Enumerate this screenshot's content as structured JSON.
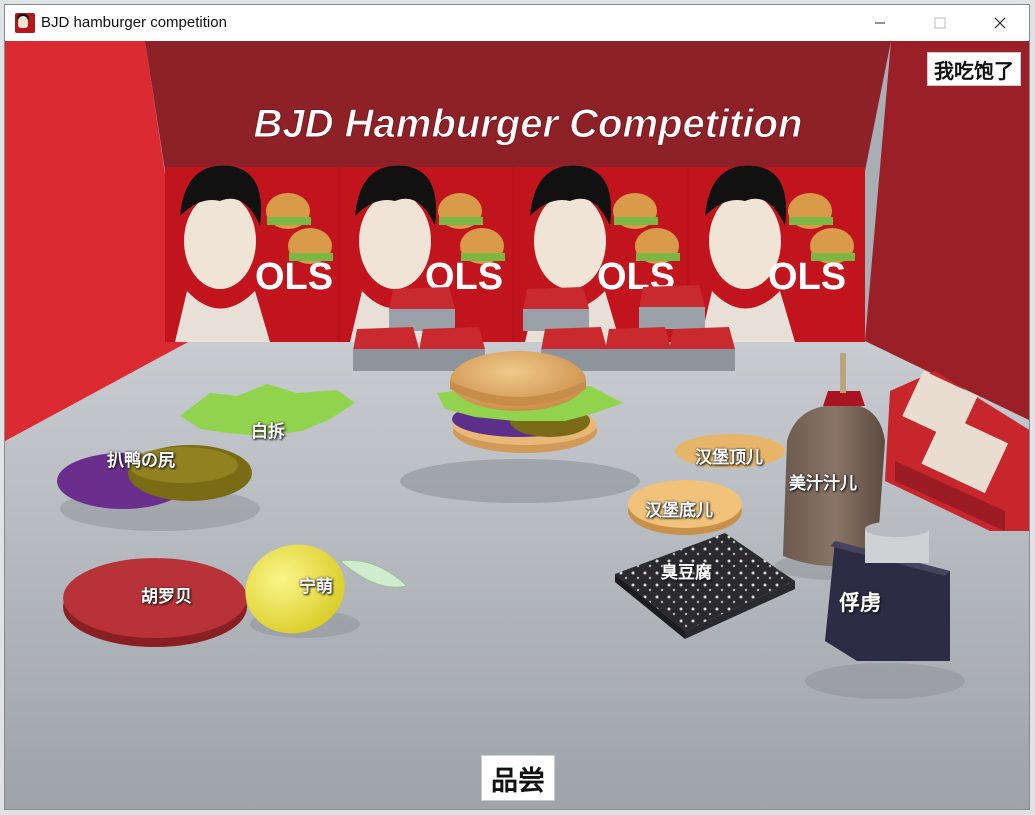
{
  "window": {
    "title": "BJD hamburger competition"
  },
  "scene": {
    "banner_text": "BJD Hamburger Competition",
    "poster_text": "OLS",
    "ingredients": [
      {
        "id": "baichai",
        "label": "白拆"
      },
      {
        "id": "bayazhipi",
        "label": "扒鸭の尻"
      },
      {
        "id": "huluobei",
        "label": "胡罗贝"
      },
      {
        "id": "ningmeng",
        "label": "宁萌"
      },
      {
        "id": "hanbao-ding",
        "label": "汉堡顶儿"
      },
      {
        "id": "hanbao-di",
        "label": "汉堡底儿"
      },
      {
        "id": "chou-doufu",
        "label": "臭豆腐"
      },
      {
        "id": "meizhi",
        "label": "美汁汁儿"
      },
      {
        "id": "fuhu",
        "label": "俘虏"
      }
    ]
  },
  "buttons": {
    "full": "我吃饱了",
    "taste": "品尝"
  },
  "colors": {
    "wall": "#c8232b",
    "floor": "#a9aeb4",
    "lettuce": "#8fd14a",
    "bun": "#e7b56a"
  }
}
